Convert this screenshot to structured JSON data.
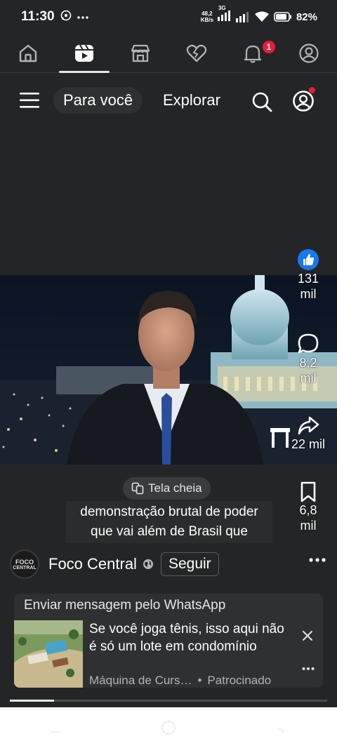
{
  "status_bar": {
    "time": "11:30",
    "net_speed_value": "48,2",
    "net_speed_unit": "KB/s",
    "network": "3G",
    "battery": "82%"
  },
  "topnav": {
    "items": [
      {
        "icon": "home-icon"
      },
      {
        "icon": "reels-icon",
        "active": true
      },
      {
        "icon": "marketplace-icon"
      },
      {
        "icon": "dating-heart-icon"
      },
      {
        "icon": "bell-icon",
        "badge": "1"
      },
      {
        "icon": "profile-icon"
      }
    ]
  },
  "reels_header": {
    "tab_for_you": "Para você",
    "tab_explore": "Explorar"
  },
  "actions": {
    "likes": "131",
    "likes_unit": "mil",
    "comments": "8,2",
    "comments_unit": "mil",
    "shares": "22 mil",
    "saves": "6,8",
    "saves_unit": "mil"
  },
  "fullscreen_label": "Tela cheia",
  "caption_line1": "demonstração brutal de poder",
  "caption_line2": "que vai além de Brasil que",
  "author": {
    "avatar_text_1": "FOCO",
    "avatar_text_2": "CENTRAL",
    "name": "Foco Central",
    "follow_label": "Seguir"
  },
  "ad": {
    "cta": "Enviar mensagem pelo WhatsApp",
    "text": "Se você joga tênis, isso aqui não é só um lote em condomínio",
    "advertiser": "Máquina de Curs…",
    "sponsored": "Patrocinado"
  },
  "video_progress": 0.14,
  "colors": {
    "accent_blue": "#1877f2",
    "badge_red": "#e41e3f",
    "background": "#242526"
  }
}
